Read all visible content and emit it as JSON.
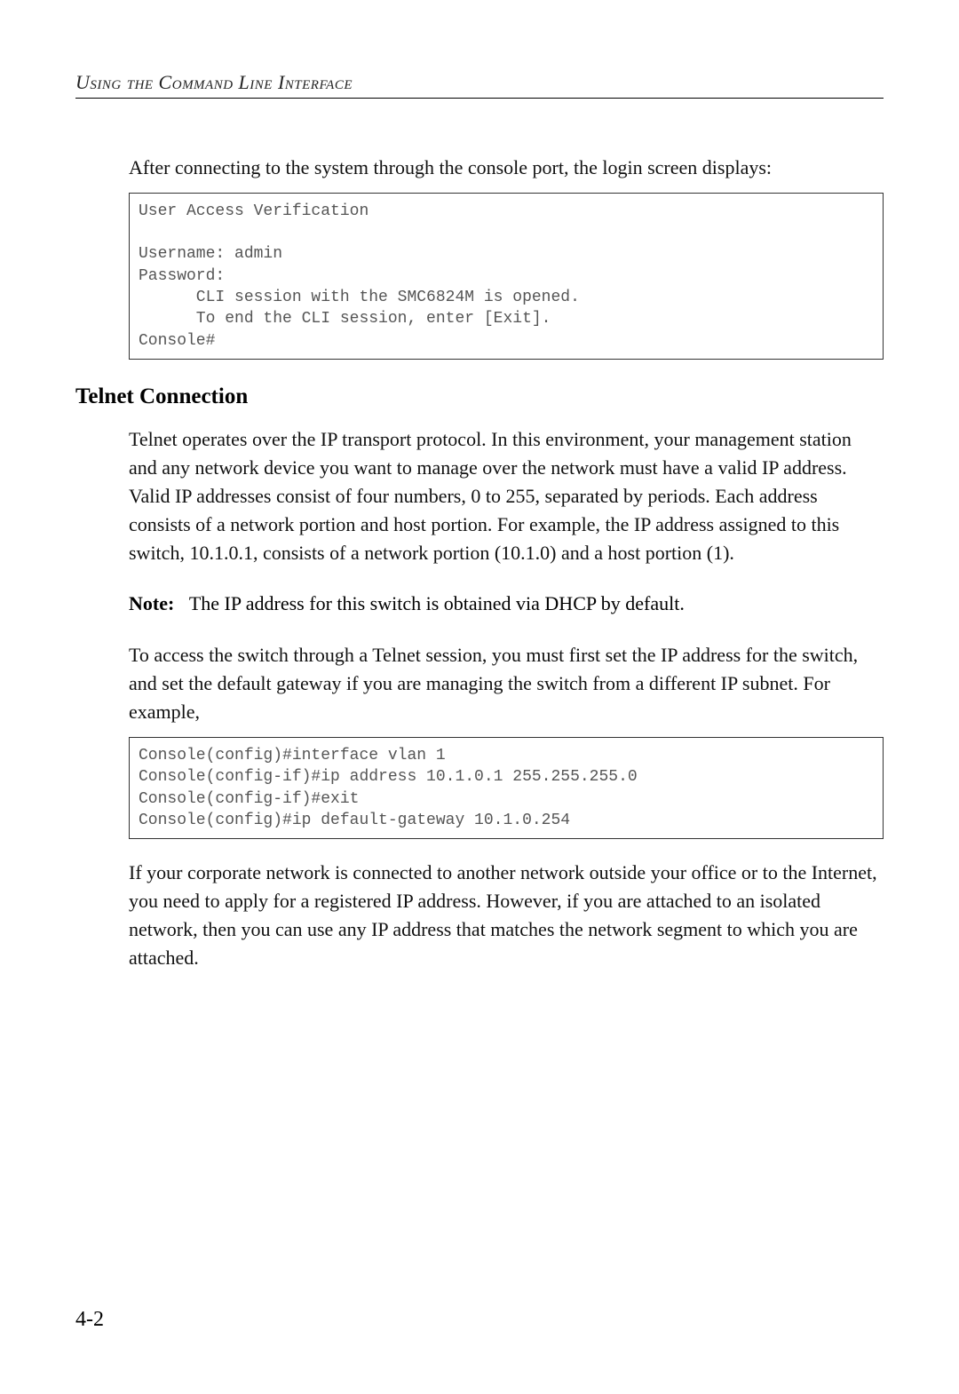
{
  "header": "Using the Command Line Interface",
  "intro": "After connecting to the system through the console port, the login screen displays:",
  "code1": "User Access Verification\n\nUsername: admin\nPassword:\n      CLI session with the SMC6824M is opened.\n      To end the CLI session, enter [Exit].\nConsole#",
  "section_heading": "Telnet Connection",
  "telnet_para": "Telnet operates over the IP transport protocol. In this environment, your management station and any network device you want to manage over the network must have a valid IP address. Valid IP addresses consist of four numbers, 0 to 255, separated by periods. Each address consists of a network portion and host portion. For example, the IP address assigned to this switch, 10.1.0.1, consists of a network portion (10.1.0) and a host portion (1).",
  "note_label": "Note:",
  "note_text": "The IP address for this switch is obtained via DHCP by default.",
  "access_para": "To access the switch through a Telnet session, you must first set the IP address for the switch, and set the default gateway if you are managing the switch from a different IP subnet. For example,",
  "code2": "Console(config)#interface vlan 1\nConsole(config-if)#ip address 10.1.0.1 255.255.255.0\nConsole(config-if)#exit\nConsole(config)#ip default-gateway 10.1.0.254",
  "closing_para": "If your corporate network is connected to another network outside your office or to the Internet, you need to apply for a registered IP address. However, if you are attached to an isolated network, then you can use any IP address that matches the network segment to which you are attached.",
  "page_number": "4-2"
}
